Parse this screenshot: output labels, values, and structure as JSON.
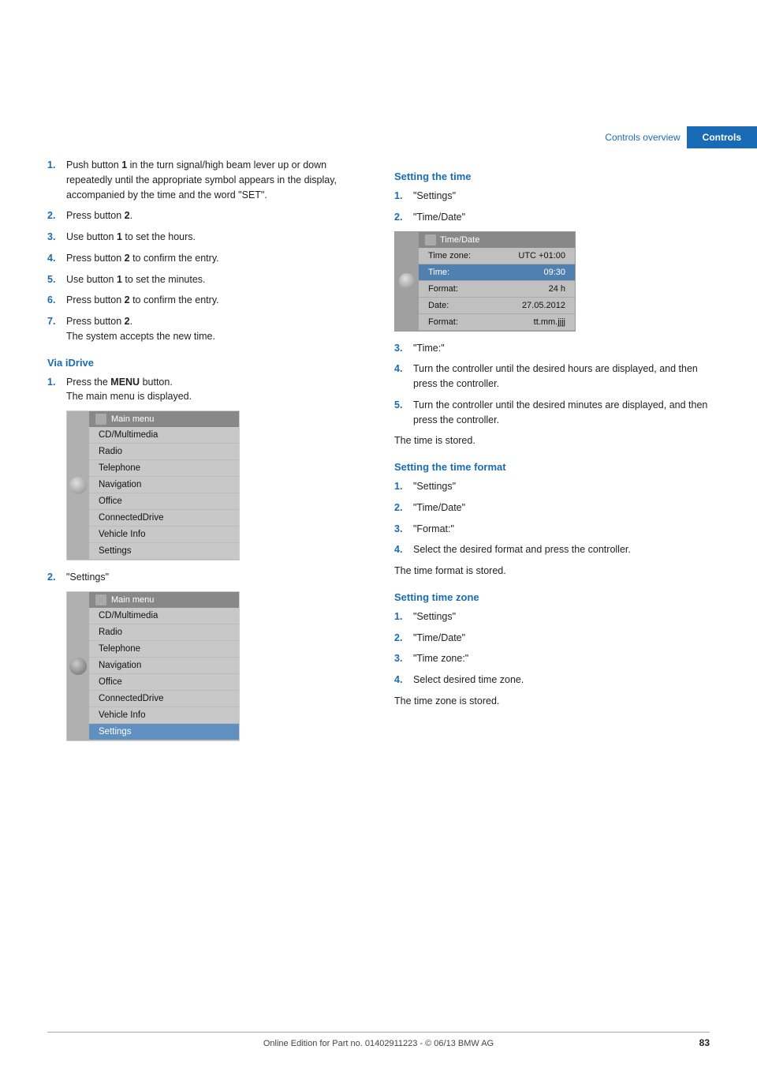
{
  "page": {
    "number": "83",
    "footer": "Online Edition for Part no. 01402911223 - © 06/13 BMW AG"
  },
  "header": {
    "controls_overview_label": "Controls overview",
    "controls_label": "Controls"
  },
  "left_column": {
    "steps": [
      {
        "num": "1.",
        "text": "Push button ",
        "bold": "1",
        "text2": " in the turn signal/high beam lever up or down repeatedly until the appropriate symbol appears in the display, accompanied by the time and the word \"SET\"."
      },
      {
        "num": "2.",
        "text": "Press button ",
        "bold": "2",
        "text2": "."
      },
      {
        "num": "3.",
        "text": "Use button ",
        "bold": "1",
        "text2": " to set the hours."
      },
      {
        "num": "4.",
        "text": "Press button ",
        "bold": "2",
        "text2": " to confirm the entry."
      },
      {
        "num": "5.",
        "text": "Use button ",
        "bold": "1",
        "text2": " to set the minutes."
      },
      {
        "num": "6.",
        "text": "Press button ",
        "bold": "2",
        "text2": " to confirm the entry."
      },
      {
        "num": "7.",
        "text": "Press button ",
        "bold": "2",
        "text2": ".\nThe system accepts the new time."
      }
    ],
    "via_idrive_heading": "Via iDrive",
    "via_idrive_steps": [
      {
        "num": "1.",
        "text": "Press the ",
        "bold": "MENU",
        "text2": " button.\nThe main menu is displayed."
      },
      {
        "num": "2.",
        "text": "\"Settings\""
      }
    ],
    "menu1": {
      "title": "Main menu",
      "items": [
        {
          "label": "CD/Multimedia",
          "highlighted": false
        },
        {
          "label": "Radio",
          "highlighted": false
        },
        {
          "label": "Telephone",
          "highlighted": false
        },
        {
          "label": "Navigation",
          "highlighted": false
        },
        {
          "label": "Office",
          "highlighted": false
        },
        {
          "label": "ConnectedDrive",
          "highlighted": false
        },
        {
          "label": "Vehicle Info",
          "highlighted": false
        },
        {
          "label": "Settings",
          "highlighted": false
        }
      ]
    },
    "menu2": {
      "title": "Main menu",
      "items": [
        {
          "label": "CD/Multimedia",
          "highlighted": false
        },
        {
          "label": "Radio",
          "highlighted": false
        },
        {
          "label": "Telephone",
          "highlighted": false
        },
        {
          "label": "Navigation",
          "highlighted": false
        },
        {
          "label": "Office",
          "highlighted": false
        },
        {
          "label": "ConnectedDrive",
          "highlighted": false
        },
        {
          "label": "Vehicle Info",
          "highlighted": false
        },
        {
          "label": "Settings",
          "highlighted": true
        }
      ]
    }
  },
  "right_column": {
    "setting_time_heading": "Setting the time",
    "setting_time_steps": [
      {
        "num": "1.",
        "text": "\"Settings\""
      },
      {
        "num": "2.",
        "text": "\"Time/Date\""
      }
    ],
    "timedate_menu": {
      "title": "Time/Date",
      "rows": [
        {
          "label": "Time zone:",
          "value": "UTC +01:00",
          "highlighted": false
        },
        {
          "label": "Time:",
          "value": "09:30",
          "highlighted": true
        },
        {
          "label": "Format:",
          "value": "24 h",
          "highlighted": false
        },
        {
          "label": "Date:",
          "value": "27.05.2012",
          "highlighted": false
        },
        {
          "label": "Format:",
          "value": "tt.mm.jjjj",
          "highlighted": false
        }
      ]
    },
    "setting_time_steps2": [
      {
        "num": "3.",
        "text": "\"Time:\""
      },
      {
        "num": "4.",
        "text": "Turn the controller until the desired hours are displayed, and then press the controller."
      },
      {
        "num": "5.",
        "text": "Turn the controller until the desired minutes are displayed, and then press the controller."
      }
    ],
    "time_stored": "The time is stored.",
    "setting_time_format_heading": "Setting the time format",
    "setting_time_format_steps": [
      {
        "num": "1.",
        "text": "\"Settings\""
      },
      {
        "num": "2.",
        "text": "\"Time/Date\""
      },
      {
        "num": "3.",
        "text": "\"Format:\""
      },
      {
        "num": "4.",
        "text": "Select the desired format and press the controller."
      }
    ],
    "time_format_stored": "The time format is stored.",
    "setting_time_zone_heading": "Setting time zone",
    "setting_time_zone_steps": [
      {
        "num": "1.",
        "text": "\"Settings\""
      },
      {
        "num": "2.",
        "text": "\"Time/Date\""
      },
      {
        "num": "3.",
        "text": "\"Time zone:\""
      },
      {
        "num": "4.",
        "text": "Select desired time zone."
      }
    ],
    "time_zone_stored": "The time zone is stored."
  }
}
